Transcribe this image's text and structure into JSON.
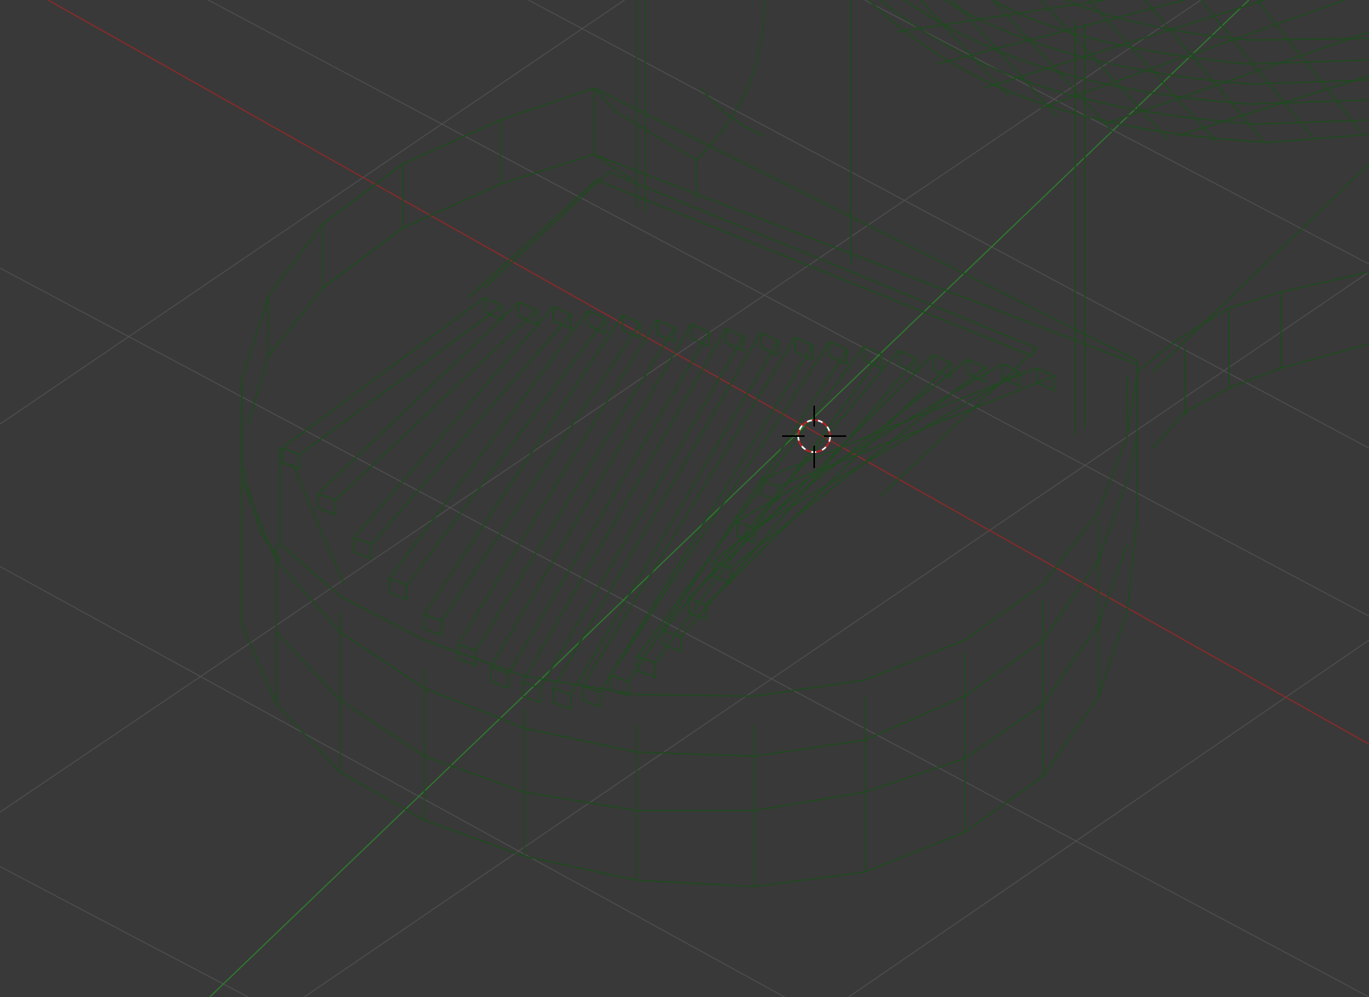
{
  "viewport": {
    "view_mode": "wireframe",
    "background_color": "#393939",
    "grid_color": "#4f4f4f",
    "x_axis_color": "#8a2a2a",
    "y_axis_color": "#2f7a2f",
    "wire_color": "#1f4a1f",
    "cursor_icon": "3d-cursor-icon"
  }
}
